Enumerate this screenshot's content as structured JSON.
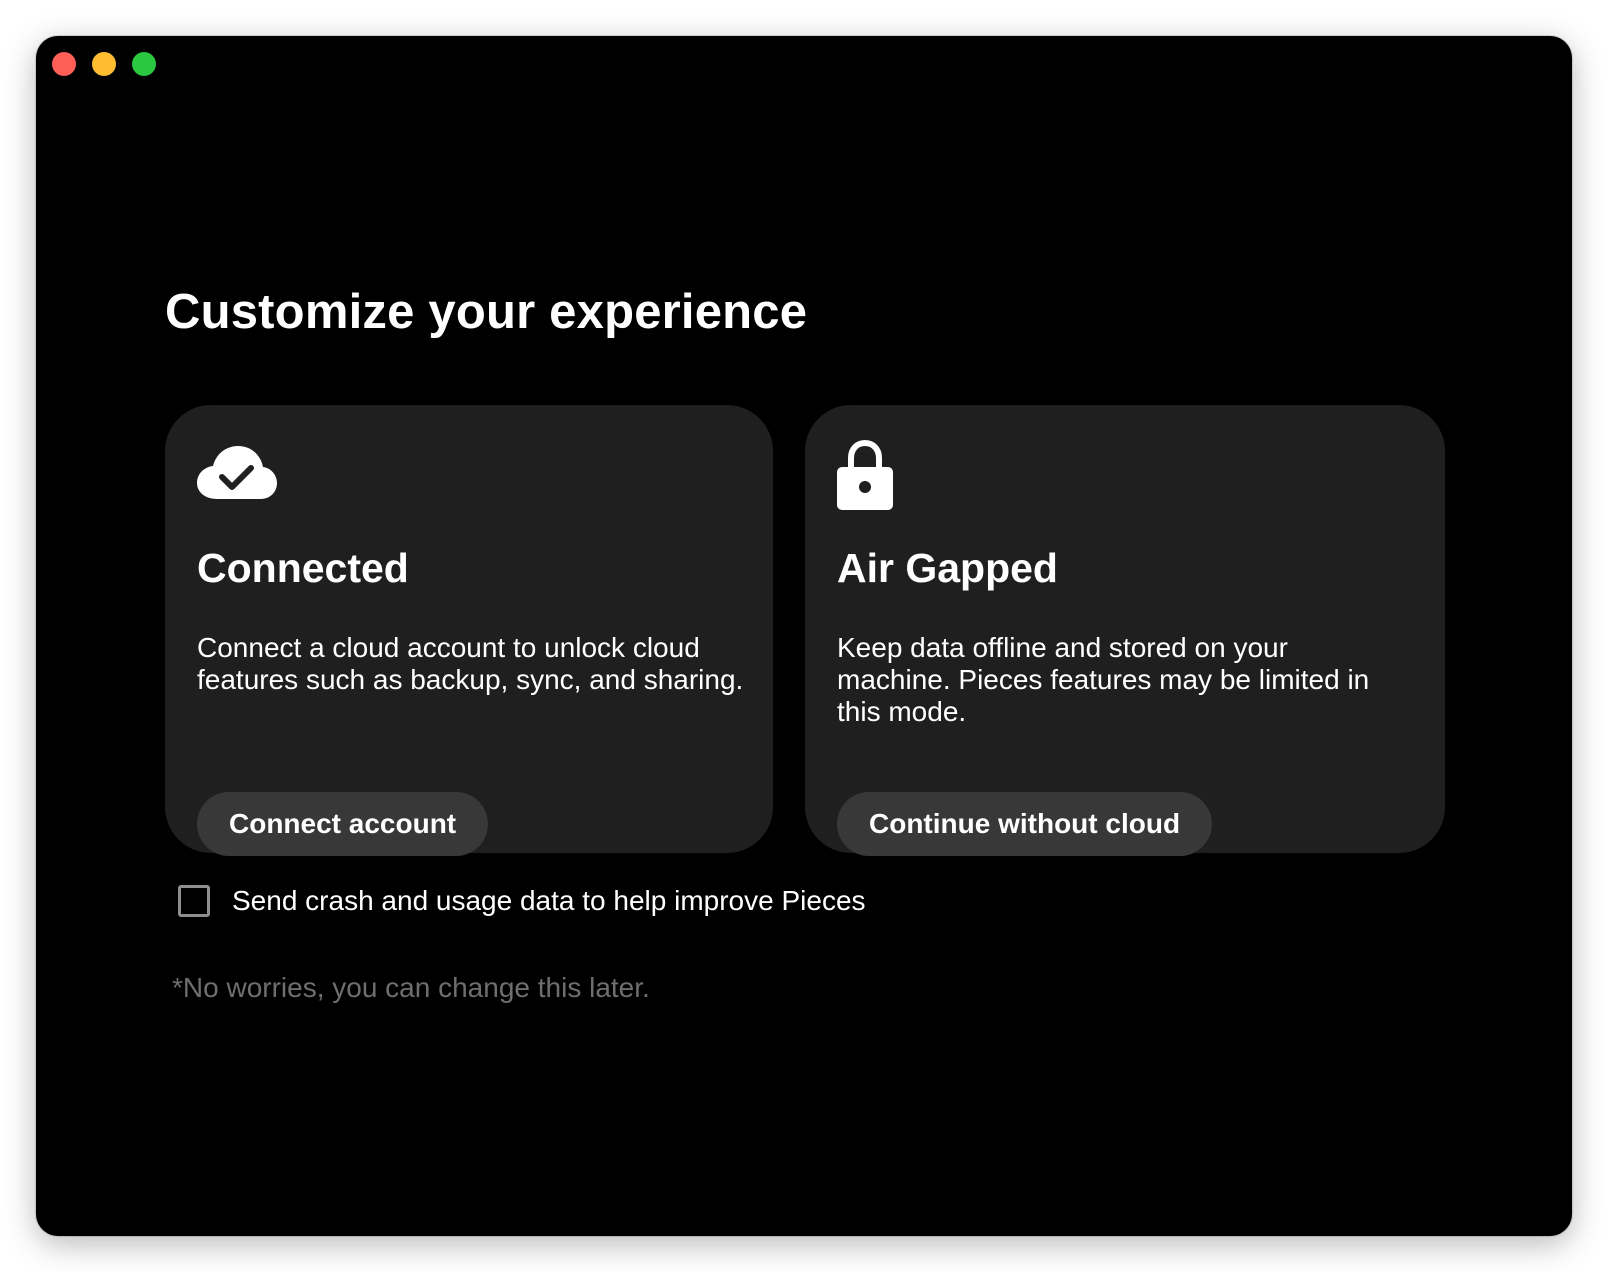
{
  "window": {
    "traffic_lights": {
      "close_color": "#fe5f57",
      "minimize_color": "#febc2e",
      "maximize_color": "#28c840"
    }
  },
  "main": {
    "title": "Customize your experience",
    "options": [
      {
        "icon": "cloud-check-icon",
        "title": "Connected",
        "description": "Connect a cloud account to unlock cloud features such as backup, sync, and sharing.",
        "button_label": "Connect account"
      },
      {
        "icon": "lock-icon",
        "title": "Air Gapped",
        "description": "Keep data offline and stored on your machine. Pieces features may be limited in this mode.",
        "button_label": "Continue without cloud"
      }
    ],
    "telemetry": {
      "label": "Send crash and usage data to help improve Pieces",
      "checked": false
    },
    "footnote": "*No worries, you can change this later."
  },
  "colors": {
    "window_background": "#000000",
    "card_background": "#1f1f1f",
    "button_background": "#383838",
    "footnote_text": "#6e6e6e"
  }
}
